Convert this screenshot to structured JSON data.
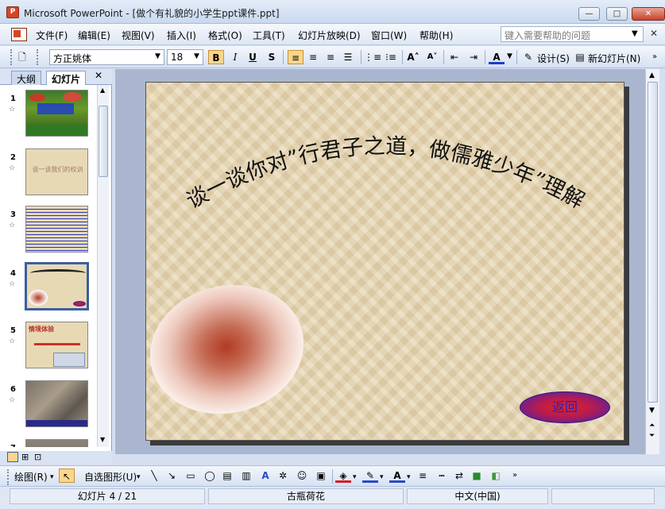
{
  "window": {
    "title": "Microsoft PowerPoint - [做个有礼貌的小学生ppt课件.ppt]",
    "app_icon_text": "P"
  },
  "menu": {
    "items": [
      "文件(F)",
      "编辑(E)",
      "视图(V)",
      "插入(I)",
      "格式(O)",
      "工具(T)",
      "幻灯片放映(D)",
      "窗口(W)",
      "帮助(H)"
    ],
    "help_placeholder": "键入需要帮助的问题"
  },
  "toolbar": {
    "font_name": "方正姚体",
    "font_size": "18",
    "bold": "B",
    "italic": "I",
    "underline": "U",
    "shadow": "S",
    "font_color": "A",
    "design_label": "设计(S)",
    "new_slide_label": "新幻灯片(N)"
  },
  "outline_pane": {
    "tabs": [
      "大纲",
      "幻灯片"
    ],
    "selected_tab": "幻灯片",
    "slides": [
      {
        "num": "1",
        "thumb_text": ""
      },
      {
        "num": "2",
        "thumb_text": "谈一谈我们的校训"
      },
      {
        "num": "3",
        "thumb_text": ""
      },
      {
        "num": "4",
        "thumb_text": ""
      },
      {
        "num": "5",
        "thumb_text": "情境体验"
      },
      {
        "num": "6",
        "thumb_text": ""
      },
      {
        "num": "7",
        "thumb_text": ""
      }
    ],
    "selected_slide": "4"
  },
  "slide": {
    "arc_title": "谈一谈你对”行君子之道，做儒雅少年”理解",
    "return_button": "返回"
  },
  "drawbar": {
    "draw_label": "绘图(R)",
    "autoshape_label": "自选图形(U)"
  },
  "status": {
    "slide_info": "幻灯片 4 / 21",
    "design": "古瓶荷花",
    "language": "中文(中国)"
  },
  "colors": {
    "accent": "#d24726",
    "title_bar": "#c9d9ef",
    "slide_bg": "#e6d5b1"
  }
}
